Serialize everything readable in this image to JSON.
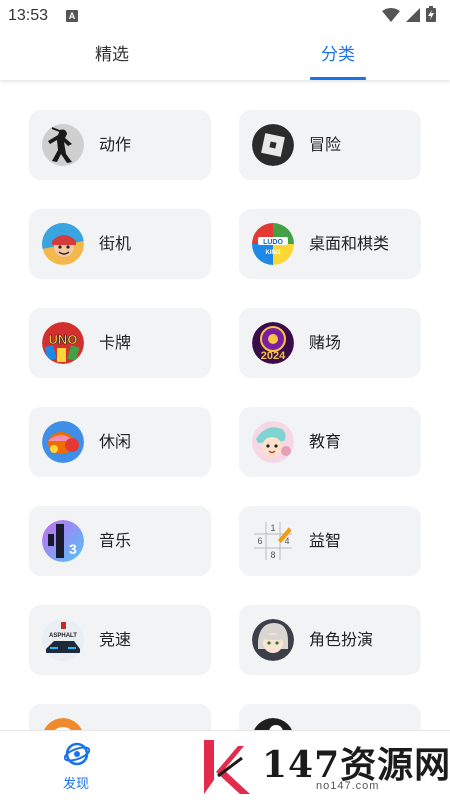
{
  "status_bar": {
    "time": "13:53",
    "notification_glyph": "A"
  },
  "tabs": [
    {
      "label": "精选",
      "active": false
    },
    {
      "label": "分类",
      "active": true
    }
  ],
  "colors": {
    "accent": "#1a73e8",
    "card_bg": "#f1f3f4"
  },
  "categories": [
    {
      "label": "动作",
      "icon": "shadow-fighter-icon"
    },
    {
      "label": "冒险",
      "icon": "roblox-icon"
    },
    {
      "label": "街机",
      "icon": "subway-surfers-icon"
    },
    {
      "label": "桌面和棋类",
      "icon": "ludo-king-icon"
    },
    {
      "label": "卡牌",
      "icon": "uno-icon"
    },
    {
      "label": "赌场",
      "icon": "casino-2024-icon"
    },
    {
      "label": "休闲",
      "icon": "candy-crush-icon"
    },
    {
      "label": "教育",
      "icon": "toca-boca-icon"
    },
    {
      "label": "音乐",
      "icon": "magic-tiles-icon"
    },
    {
      "label": "益智",
      "icon": "sudoku-icon"
    },
    {
      "label": "竞速",
      "icon": "asphalt-icon"
    },
    {
      "label": "角色扮演",
      "icon": "anime-character-icon"
    },
    {
      "label": "",
      "icon": "partial-orange-icon"
    },
    {
      "label": "",
      "icon": "partial-pool-ball-icon"
    }
  ],
  "bottom_nav": {
    "discover_label": "发现"
  },
  "watermark": {
    "text": "147资源网",
    "url": "no147.com"
  }
}
